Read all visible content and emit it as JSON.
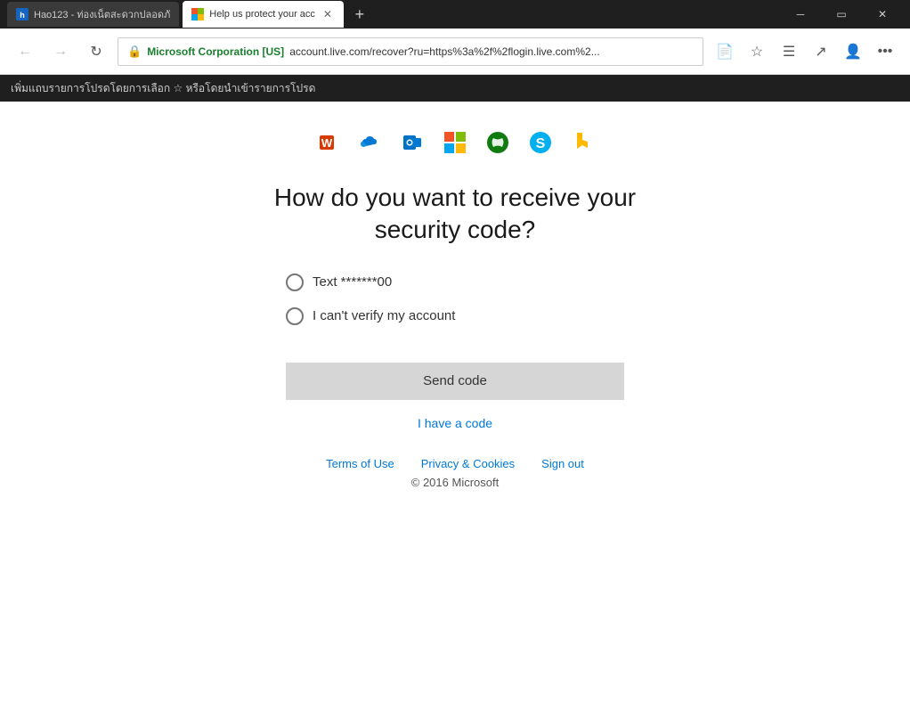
{
  "titlebar": {
    "tab1_title": "Hao123 - ท่องเน็ตสะดวกปลอดภั",
    "tab2_title": "Help us protect your acc",
    "new_tab_label": "+"
  },
  "addressbar": {
    "back_btn": "←",
    "forward_btn": "→",
    "refresh_btn": "↻",
    "secure_label": "Microsoft Corporation [US]",
    "url": "account.live.com/recover?ru=https%3a%2f%2flogin.live.com%2..."
  },
  "bookmarkbar": {
    "text": "เพิ่มแถบรายการโปรดโดยการเลือก ☆ หรือโดยนำเข้ารายการโปรด"
  },
  "page": {
    "heading": "How do you want to receive your security code?",
    "options": [
      {
        "id": "text",
        "label": "Text *******00",
        "selected": false
      },
      {
        "id": "cant-verify",
        "label": "I can't verify my account",
        "selected": false
      }
    ],
    "send_code_btn": "Send code",
    "i_have_code_link": "I have a code",
    "footer_links": [
      {
        "label": "Terms of Use"
      },
      {
        "label": "Privacy & Cookies"
      },
      {
        "label": "Sign out"
      }
    ],
    "copyright": "© 2016 Microsoft"
  },
  "icons": {
    "office": "Office",
    "onedrive": "OneDrive",
    "outlook": "Outlook",
    "microsoft": "Microsoft",
    "xbox": "Xbox",
    "skype": "Skype",
    "bing": "Bing"
  }
}
